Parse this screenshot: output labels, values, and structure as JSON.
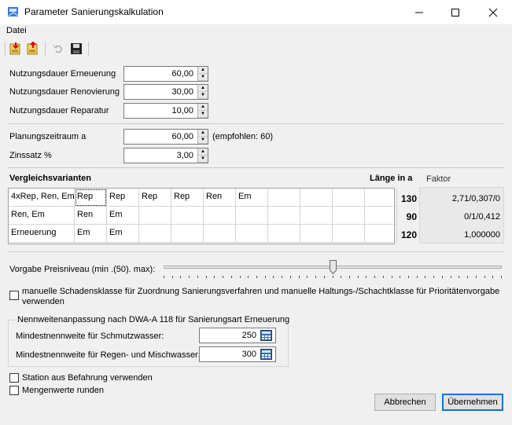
{
  "window": {
    "title": "Parameter Sanierungskalkulation"
  },
  "menu": {
    "items": [
      "Datei"
    ]
  },
  "toolbar": {
    "icons": [
      "import-icon",
      "export-icon",
      "undo-icon",
      "save-icon"
    ]
  },
  "fields": {
    "erneuerung": {
      "label": "Nutzungsdauer Erneuerung",
      "value": "60,00"
    },
    "renovierung": {
      "label": "Nutzungsdauer Renovierung",
      "value": "30,00"
    },
    "reparatur": {
      "label": "Nutzungsdauer Reparatur",
      "value": "10,00"
    },
    "planungszeitraum": {
      "label": "Planungszeitraum a",
      "value": "60,00",
      "hint": "(empfohlen: 60)"
    },
    "zinssatz": {
      "label": "Zinssatz %",
      "value": "3,00"
    }
  },
  "variants": {
    "title": "Vergleichsvarianten",
    "length_header": "Länge in a",
    "factor_header": "Faktor",
    "rows": [
      {
        "name": "4xRep, Ren, Em",
        "cells": [
          "Rep",
          "Rep",
          "Rep",
          "Rep",
          "Ren",
          "Em",
          "",
          "",
          "",
          ""
        ],
        "length": "130",
        "factor": "2,71/0,307/0"
      },
      {
        "name": "Ren, Em",
        "cells": [
          "Ren",
          "Em",
          "",
          "",
          "",
          "",
          "",
          "",
          "",
          ""
        ],
        "length": "90",
        "factor": "0/1/0,412"
      },
      {
        "name": "Erneuerung",
        "cells": [
          "Em",
          "Em",
          "",
          "",
          "",
          "",
          "",
          "",
          "",
          ""
        ],
        "length": "120",
        "factor": "1,000000"
      }
    ]
  },
  "slider": {
    "label": "Vorgabe Preisniveau (min .(50). max):",
    "value_percent": 50
  },
  "checkboxes": {
    "manuell": {
      "line1": "manuelle Schadensklasse für Zuordnung Sanierungsverfahren und manuelle Haltungs-/Schachtklasse für Prioritätenvorgabe",
      "line2": "verwenden",
      "checked": false
    },
    "station": {
      "label": "Station aus Befahrung verwenden",
      "checked": false
    },
    "runden": {
      "label": "Mengenwerte runden",
      "checked": false
    }
  },
  "nennweite": {
    "title": "Nennweitenanpassung nach DWA-A 118 für Sanierungsart Erneuerung",
    "schmutz": {
      "label": "Mindestnennweite für Schmutzwasser:",
      "value": "250"
    },
    "regen": {
      "label": "Mindestnennweite für Regen- und Mischwasser:",
      "value": "300"
    }
  },
  "buttons": {
    "cancel": "Abbrechen",
    "ok": "Übernehmen"
  }
}
